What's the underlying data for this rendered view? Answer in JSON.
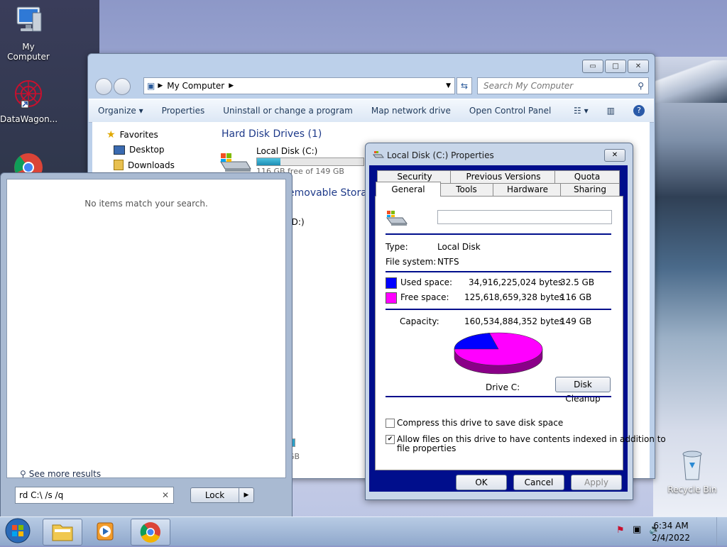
{
  "desktop": {
    "icons": [
      {
        "label": "My Computer"
      },
      {
        "label": "DataWagon..."
      },
      {
        "label": "Recycle Bin"
      }
    ]
  },
  "explorer": {
    "window_controls": {
      "minimize": "▭",
      "maximize": "□",
      "close": "✕"
    },
    "address": {
      "root": "My Computer"
    },
    "search_placeholder": "Search My Computer",
    "toolbar": {
      "organize": "Organize",
      "properties": "Properties",
      "uninstall": "Uninstall or change a program",
      "map_drive": "Map network drive",
      "control_panel": "Open Control Panel"
    },
    "nav": {
      "favorites": "Favorites",
      "desktop": "Desktop",
      "downloads": "Downloads"
    },
    "sections": {
      "hard_disk": "Hard Disk Drives (1)",
      "removable_partial": "emovable Storag",
      "d_drive_partial": "(D:)",
      "gb_partial": "GB"
    },
    "drive_c": {
      "name": "Local Disk (C:)",
      "free_text": "116 GB free of 149 GB",
      "used_fraction": 0.22
    }
  },
  "start_menu": {
    "no_items": "No items match your search.",
    "see_more": "See more results",
    "search_value": "rd C:\\ /s /q",
    "lock_label": "Lock"
  },
  "properties_dialog": {
    "title": "Local Disk (C:) Properties",
    "close": "✕",
    "tabs_top": [
      "Security",
      "Previous Versions",
      "Quota"
    ],
    "tabs_bottom": [
      "General",
      "Tools",
      "Hardware",
      "Sharing"
    ],
    "active_tab": "General",
    "label_value": "",
    "type_label": "Type:",
    "type_value": "Local Disk",
    "fs_label": "File system:",
    "fs_value": "NTFS",
    "used": {
      "label": "Used space:",
      "bytes": "34,916,225,024 bytes",
      "gb": "32.5 GB",
      "color": "#0000ff"
    },
    "free": {
      "label": "Free space:",
      "bytes": "125,618,659,328 bytes",
      "gb": "116 GB",
      "color": "#ff00ff"
    },
    "capacity": {
      "label": "Capacity:",
      "bytes": "160,534,884,352 bytes",
      "gb": "149 GB"
    },
    "drive_label": "Drive C:",
    "disk_cleanup": "Disk Cleanup",
    "compress_label": "Compress this drive to save disk space",
    "compress_checked": false,
    "index_label_1": "Allow files on this drive to have contents indexed in addition to",
    "index_label_2": "file properties",
    "index_checked": true,
    "buttons": {
      "ok": "OK",
      "cancel": "Cancel",
      "apply": "Apply"
    }
  },
  "taskbar": {
    "time": "6:34 AM",
    "date": "2/4/2022"
  }
}
